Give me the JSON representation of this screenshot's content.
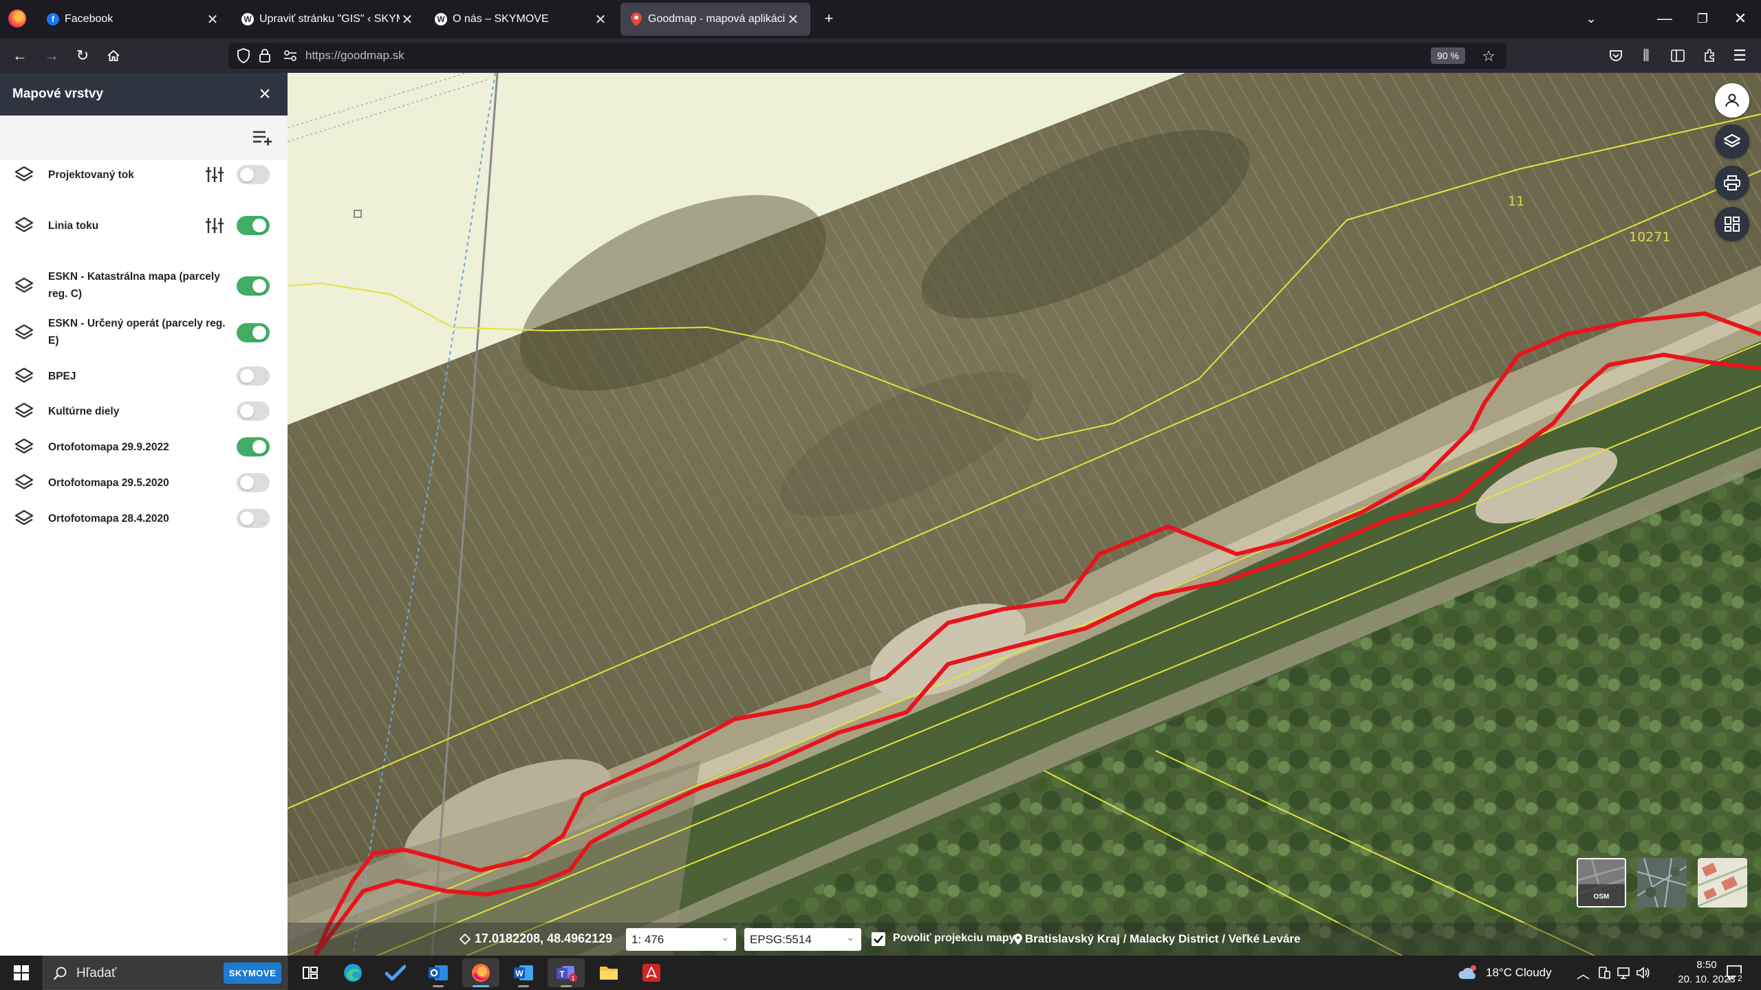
{
  "browser": {
    "tabs": [
      {
        "label": "Facebook",
        "favicon_color": "#1877f2",
        "favicon_letter": "f",
        "active": false
      },
      {
        "label": "Upraviť stránku \"GIS\" ‹ SKYMOVE",
        "favicon_color": "#ffffff",
        "favicon_letter": "W",
        "active": false
      },
      {
        "label": "O nás – SKYMOVE",
        "favicon_color": "#ffffff",
        "favicon_letter": "W",
        "active": false
      },
      {
        "label": "Goodmap - mapová aplikácia",
        "favicon_color": "#e8463b",
        "favicon_letter": "",
        "active": true
      }
    ],
    "url": "https://goodmap.sk",
    "zoom": "90 %"
  },
  "sidebar": {
    "title": "Mapové vrstvy",
    "layers": [
      {
        "label": "Projektovaný tok",
        "enabled": false,
        "has_options": true
      },
      {
        "label": "Linia toku",
        "enabled": true,
        "has_options": true
      },
      {
        "label": "ESKN - Katastrálna mapa (parcely reg. C)",
        "enabled": true,
        "has_options": false
      },
      {
        "label": "ESKN - Určený operát (parcely reg. E)",
        "enabled": true,
        "has_options": false
      },
      {
        "label": "BPEJ",
        "enabled": false,
        "has_options": false
      },
      {
        "label": "Kultúrne diely",
        "enabled": false,
        "has_options": false
      },
      {
        "label": "Ortofotomapa 29.9.2022",
        "enabled": true,
        "has_options": false
      },
      {
        "label": "Ortofotomapa 29.5.2020",
        "enabled": false,
        "has_options": false
      },
      {
        "label": "Ortofotomapa 28.4.2020",
        "enabled": false,
        "has_options": false
      }
    ]
  },
  "map": {
    "parcel_labels": [
      "11",
      "10271"
    ],
    "basemaps": [
      {
        "name": "OSM"
      },
      {
        "name": ""
      },
      {
        "name": ""
      }
    ],
    "status": {
      "coordinates": "17.0182208, 48.4962129",
      "scale": "1: 476",
      "projection": "EPSG:5514",
      "projection_checkbox_label": "Povoliť projekciu mapy",
      "projection_enabled": true,
      "location": "Bratislavský Kraj / Malacky District / Veľké Leváre"
    },
    "colors": {
      "stream_line": "#e8141c",
      "parcel_line": "#e6e23a",
      "toggle_on": "#3fae64"
    }
  },
  "taskbar": {
    "search_placeholder": "Hľadať",
    "search_badge": "SKYMOVE",
    "weather": "18°C  Cloudy",
    "time": "8:50",
    "date": "20. 10. 2023",
    "notifications": "2"
  }
}
